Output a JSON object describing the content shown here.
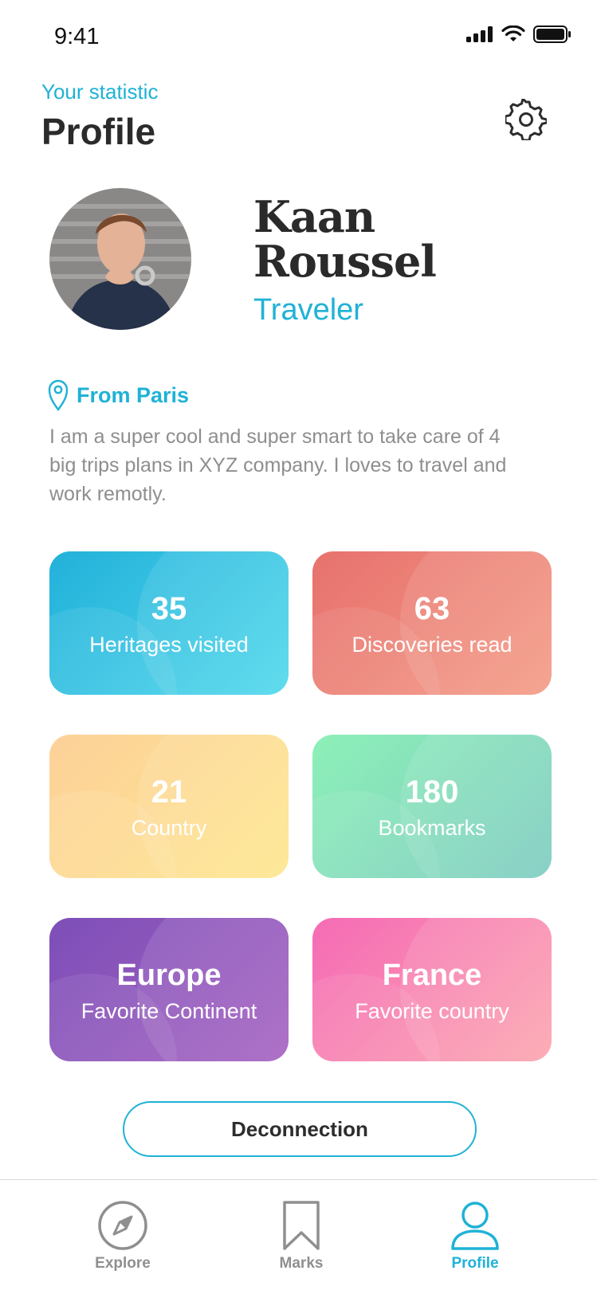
{
  "status_bar": {
    "time": "9:41"
  },
  "header": {
    "subtitle": "Your statistic",
    "title": "Profile"
  },
  "profile": {
    "name": "Kaan Roussel",
    "role": "Traveler",
    "location": "From Paris",
    "bio": "I am a super cool and super smart to take care of 4 big trips plans in XYZ company. I loves to travel and work remotly."
  },
  "stats": [
    {
      "value": "35",
      "label": "Heritages visited"
    },
    {
      "value": "63",
      "label": "Discoveries read"
    },
    {
      "value": "21",
      "label": "Country"
    },
    {
      "value": "180",
      "label": "Bookmarks"
    },
    {
      "value": "Europe",
      "label": "Favorite Continent"
    },
    {
      "value": "France",
      "label": "Favorite country"
    }
  ],
  "actions": {
    "disconnect_label": "Deconnection"
  },
  "tabbar": {
    "items": [
      {
        "label": "Explore",
        "icon": "compass-icon",
        "active": false
      },
      {
        "label": "Marks",
        "icon": "bookmark-icon",
        "active": false
      },
      {
        "label": "Profile",
        "icon": "user-icon",
        "active": true
      }
    ]
  },
  "colors": {
    "accent": "#1fb2d6",
    "card_blue": "#23b1da",
    "card_red": "#e7716e",
    "card_yellow": "#fdd19a",
    "card_green": "#8ef0b8",
    "card_purple": "#7d4fb8",
    "card_pink": "#f56bb6"
  }
}
